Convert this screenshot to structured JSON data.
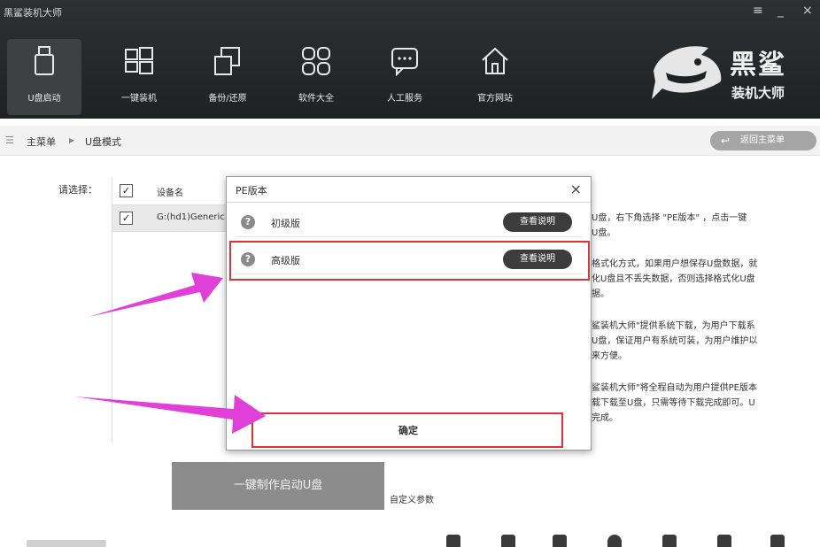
{
  "app": {
    "title": "黑鲨装机大师",
    "window_controls": {
      "menu": "≡",
      "minimize": "_",
      "close": "×"
    },
    "logo_text": "黑鲨",
    "logo_subtext": "装机大师"
  },
  "nav": [
    {
      "label": "U盘启动",
      "icon": "usb-icon",
      "active": true
    },
    {
      "label": "一键装机",
      "icon": "windows-icon",
      "active": false
    },
    {
      "label": "备份/还原",
      "icon": "backup-icon",
      "active": false
    },
    {
      "label": "软件大全",
      "icon": "apps-icon",
      "active": false
    },
    {
      "label": "人工服务",
      "icon": "chat-icon",
      "active": false
    },
    {
      "label": "官方网站",
      "icon": "home-icon",
      "active": false
    }
  ],
  "breadcrumb": {
    "menu_icon": "list-icon",
    "root": "主菜单",
    "separator": "▶",
    "current": "U盘模式",
    "back_label": "返回主菜单"
  },
  "main": {
    "select_label": "请选择：",
    "table": {
      "header": "设备名",
      "header_checked": true,
      "rows": [
        {
          "device": "G:(hd1)Generic",
          "checked": true
        }
      ]
    },
    "info_lines": [
      "U盘，右下角选择 \"PE版本\" ，点击一键",
      "U盘。",
      "格式化方式，如果用户想保存U盘数据，就",
      "化U盘且不丢失数据，否则选择格式化U盘",
      "据。",
      "鲨装机大师\"提供系统下载，为用户下载系",
      "U盘，保证用户有系统可装，为用户维护以",
      "来方便。",
      "鲨装机大师\"将全程自动为用户提供PE版本",
      "载下载至U盘，只需等待下载完成即可。U",
      "完成。"
    ],
    "make_button": "一键制作启动U盘",
    "custom_params": "自定义参数"
  },
  "dialog": {
    "title": "PE版本",
    "close": "×",
    "options": [
      {
        "name": "初级版",
        "view_label": "查看说明"
      },
      {
        "name": "高级版",
        "view_label": "查看说明"
      }
    ],
    "confirm": "确定"
  },
  "colors": {
    "topbar": "#2a2c2d",
    "highlight_box": "#e0303a",
    "arrow": "#e040d8",
    "view_button": "#3c3c3c",
    "make_button": "#8c8c8c"
  }
}
